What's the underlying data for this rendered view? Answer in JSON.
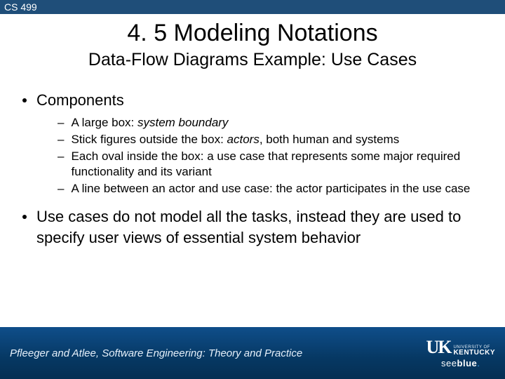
{
  "header": {
    "course": "CS 499",
    "title": "4. 5 Modeling Notations",
    "subtitle": "Data-Flow Diagrams Example: Use Cases"
  },
  "bullets": {
    "b1": {
      "label": "Components"
    },
    "sub": {
      "s1a": "A large box: ",
      "s1k": "system boundary",
      "s2a": "Stick figures outside the box: ",
      "s2k": "actors",
      "s2b": ", both human and systems",
      "s3a": "Each oval inside the box: a use case that represents some major required functionality and its variant",
      "s4a": "A line between an actor and use case: the actor participates in the use case"
    },
    "b2": {
      "label": "Use cases do not model all the tasks, instead they are used to specify user views of essential system behavior"
    }
  },
  "footer": {
    "citation": "Pfleeger and Atlee, Software Engineering: Theory and Practice",
    "logo_mark": "UK",
    "logo_uni": "UNIVERSITY OF",
    "logo_ky": "KENTUCKY",
    "tagline_a": "see",
    "tagline_b": "blue",
    "tagline_dot": "."
  }
}
